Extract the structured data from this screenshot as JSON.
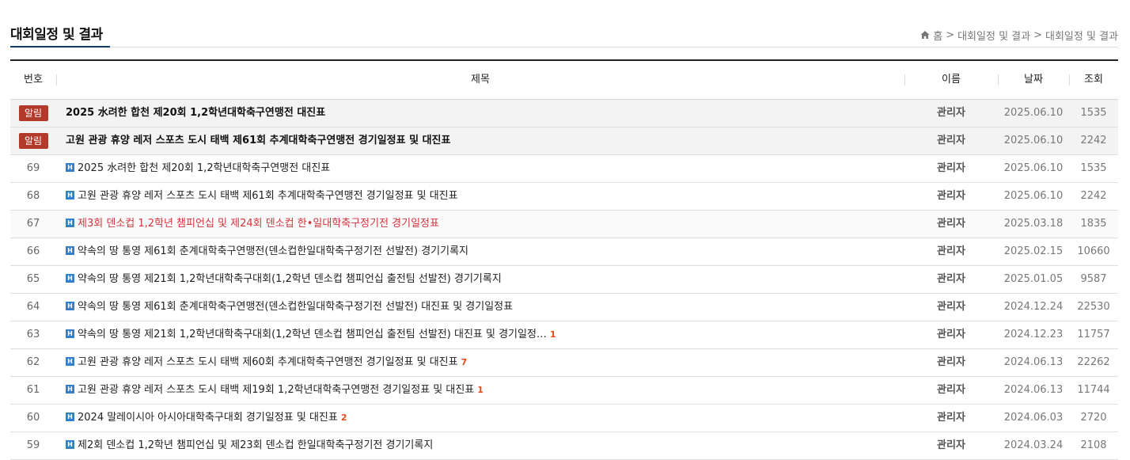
{
  "page": {
    "title": "대회일정 및 결과",
    "breadcrumb": [
      "홈",
      "대회일정 및 결과",
      "대회일정 및 결과"
    ]
  },
  "table": {
    "headers": {
      "num": "번호",
      "title": "제목",
      "name": "이름",
      "date": "날짜",
      "views": "조회"
    },
    "notice_badge": "알림",
    "rows": [
      {
        "type": "notice",
        "num": "",
        "title": "2025 水려한 합천 제20회 1,2학년대학축구연맹전 대진표",
        "name": "관리자",
        "date": "2025.06.10",
        "views": "1535"
      },
      {
        "type": "notice",
        "num": "",
        "title": "고원 관광 휴양 레저 스포츠 도시 태백 제61회 추계대학축구연맹전 경기일정표 및 대진표",
        "name": "관리자",
        "date": "2025.06.10",
        "views": "2242"
      },
      {
        "type": "normal",
        "num": "69",
        "title": "2025 水려한 합천 제20회 1,2학년대학축구연맹전 대진표",
        "comments": "",
        "name": "관리자",
        "date": "2025.06.10",
        "views": "1535"
      },
      {
        "type": "normal",
        "num": "68",
        "title": "고원 관광 휴양 레저 스포츠 도시 태백 제61회 추계대학축구연맹전 경기일정표 및 대진표",
        "comments": "",
        "name": "관리자",
        "date": "2025.06.10",
        "views": "2242"
      },
      {
        "type": "highlight",
        "num": "67",
        "title": "제3회 덴소컵 1,2학년 챔피언십 및 제24회 덴소컵 한•일대학축구정기전 경기일정표",
        "comments": "",
        "name": "관리자",
        "date": "2025.03.18",
        "views": "1835"
      },
      {
        "type": "normal",
        "num": "66",
        "title": "약속의 땅 통영 제61회 춘계대학축구연맹전(덴소컵한일대학축구정기전 선발전) 경기기록지",
        "comments": "",
        "name": "관리자",
        "date": "2025.02.15",
        "views": "10660"
      },
      {
        "type": "normal",
        "num": "65",
        "title": "약속의 땅 통영 제21회 1,2학년대학축구대회(1,2학년 덴소컵 챔피언십 출전팀 선발전) 경기기록지",
        "comments": "",
        "name": "관리자",
        "date": "2025.01.05",
        "views": "9587"
      },
      {
        "type": "normal",
        "num": "64",
        "title": "약속의 땅 통영 제61회 춘계대학축구연맹전(덴소컵한일대학축구정기전 선발전) 대진표 및 경기일정표",
        "comments": "",
        "name": "관리자",
        "date": "2024.12.24",
        "views": "22530"
      },
      {
        "type": "normal",
        "num": "63",
        "title": "약속의 땅 통영 제21회 1,2학년대학축구대회(1,2학년 덴소컵 챔피언십 출전팀 선발전) 대진표 및 경기일정…",
        "comments": "1",
        "name": "관리자",
        "date": "2024.12.23",
        "views": "11757"
      },
      {
        "type": "normal",
        "num": "62",
        "title": "고원 관광 휴양 레저 스포츠 도시 태백 제60회 추계대학축구연맹전 경기일정표 및 대진표",
        "comments": "7",
        "name": "관리자",
        "date": "2024.06.13",
        "views": "22262"
      },
      {
        "type": "normal",
        "num": "61",
        "title": "고원 관광 휴양 레저 스포츠 도시 태백 제19회 1,2학년대학축구연맹전 경기일정표 및 대진표",
        "comments": "1",
        "name": "관리자",
        "date": "2024.06.13",
        "views": "11744"
      },
      {
        "type": "normal",
        "num": "60",
        "title": "2024 말레이시아 아시아대학축구대회 경기일정표 및 대진표",
        "comments": "2",
        "name": "관리자",
        "date": "2024.06.03",
        "views": "2720"
      },
      {
        "type": "normal",
        "num": "59",
        "title": "제2회 덴소컵 1,2학년 챔피언십 및 제23회 덴소컵 한일대학축구정기전 경기기록지",
        "comments": "",
        "name": "관리자",
        "date": "2024.03.24",
        "views": "2108"
      }
    ]
  },
  "colors": {
    "notice_badge": "#b13a2a",
    "highlight_title": "#d0343f",
    "comment_count": "#e24a1b",
    "title_underline": "#0f3d64",
    "h_icon": "#2f7fd2"
  },
  "icons": {
    "home": "home-icon",
    "file": "h-file-icon"
  }
}
